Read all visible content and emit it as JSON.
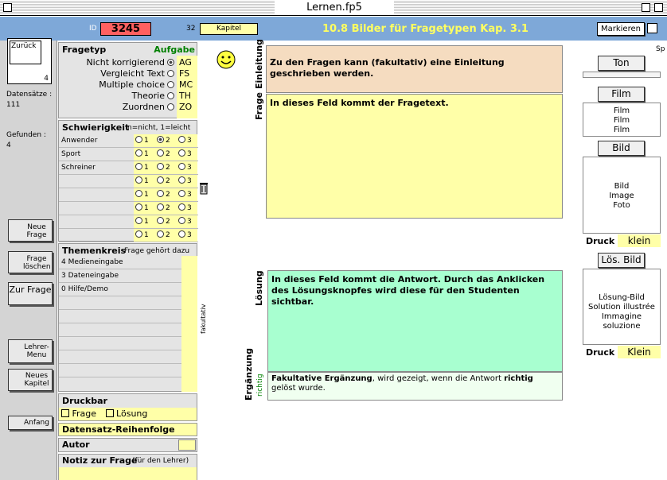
{
  "window": {
    "title": "Lernen.fp5"
  },
  "header": {
    "id_label": "ID",
    "id_value": "3245",
    "chapter_num": "32",
    "chapter_label": "Kapitel",
    "title": "10.8 Bilder für Fragetypen Kap. 3.1",
    "markieren": "Markieren"
  },
  "sidebar": {
    "back": "Zurück",
    "page_num": "4",
    "records_label": "Datensätze :",
    "records_value": "111",
    "found_label": "Gefunden :",
    "found_value": "4",
    "buttons": [
      "Neue Frage",
      "Frage löschen",
      "Zur Frage",
      "Lehrer-Menu",
      "Neues Kapitel",
      "Anfang"
    ]
  },
  "fragetyp": {
    "title": "Fragetyp",
    "aufgabe": "Aufgabe",
    "items": [
      {
        "label": "Nicht korrigierend",
        "code": "AG"
      },
      {
        "label": "Vergleicht Text",
        "code": "FS"
      },
      {
        "label": "Multiple choice",
        "code": "MC"
      },
      {
        "label": "Theorie",
        "code": "TH"
      },
      {
        "label": "Zuordnen",
        "code": "ZO"
      }
    ]
  },
  "schwierigkeit": {
    "title": "Schwierigkeit",
    "hint": "n=nicht, 1=leicht",
    "rows": [
      "Anwender",
      "Sport",
      "Schreiner",
      "",
      "",
      "",
      "",
      ""
    ],
    "opts": [
      "1",
      "2",
      "3"
    ],
    "selected_row": 0,
    "selected_opt": 1
  },
  "themenkreis": {
    "title": "Themenkreis",
    "hint": "Frage gehört dazu",
    "items": [
      "4 Medieneingabe",
      "3 Dateneingabe",
      "0 Hilfe/Demo",
      "",
      "",
      "",
      "",
      "",
      ""
    ],
    "side": "fakultativ"
  },
  "druckbar": {
    "title": "Druckbar",
    "frage": "Frage",
    "loesung": "Lösung"
  },
  "reihenfolge": {
    "title": "Datensatz-Reihenfolge"
  },
  "autor": {
    "title": "Autor"
  },
  "notiz": {
    "title": "Notiz zur Frage",
    "hint": "(für den Lehrer)"
  },
  "content": {
    "einleitung_label": "Einleitung",
    "einleitung": "Zu den Fragen kann (fakultativ) eine Einleitung geschrieben werden.",
    "frage_label": "Frage",
    "frage": "In dieses Feld kommt der Fragetext.",
    "loesung_label": "Lösung",
    "loesung": "In dieses Feld kommt die Antwort. Durch das Anklicken des Lösungsknopfes wird diese für den Studenten sichtbar.",
    "ergaenzung_label": "Ergänzung",
    "richtig_label": "richtig",
    "ergaenzung_a": "Fakultative Ergänzung",
    "ergaenzung_b": ", wird gezeigt, wenn die Antwort ",
    "ergaenzung_c": "richtig",
    "ergaenzung_d": " gelöst wurde."
  },
  "right": {
    "sp": "Sp",
    "ton": "Ton",
    "film": "Film",
    "film_lines": [
      "Film",
      "Film",
      "Film"
    ],
    "bild": "Bild",
    "bild_lines": [
      "Bild",
      "Image",
      "Foto"
    ],
    "druck": "Druck",
    "klein1": "klein",
    "loes_bild": "Lös. Bild",
    "loes_lines": [
      "Lösung-Bild",
      "Solution illustrée",
      "Immagine soluzione"
    ],
    "klein2": "Klein"
  },
  "colors": {
    "header": "#7ea8d8",
    "title_text": "#ffff60",
    "id_bg": "#ff6060",
    "yellow": "#ffffa8",
    "einleitung": "#f5dcc0",
    "frage": "#ffffa8",
    "loesung": "#a8ffd0",
    "ergaenzung": "#f0fff0"
  }
}
